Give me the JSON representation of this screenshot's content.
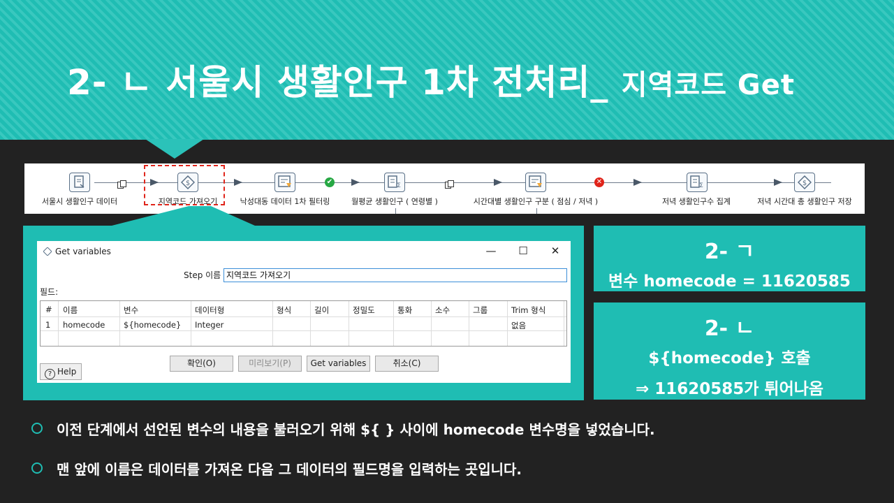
{
  "title": {
    "main": "2- ㄴ 서울시 생활인구 1차 전처리_",
    "sub": "지역코드 Get"
  },
  "pipeline": {
    "steps": [
      {
        "label": "서울시 생활인구 데이터",
        "icon": "text-file-input-icon"
      },
      {
        "label": "지역코드 가져오기",
        "icon": "get-variables-icon"
      },
      {
        "label": "낙성대동 데이터 1차 필터링",
        "icon": "filter-rows-icon"
      },
      {
        "label": "월평균 생활인구 ( 연령별 )",
        "icon": "group-by-icon"
      },
      {
        "label": "시간대별 생활인구 구분 ( 점심 / 저녁 )",
        "icon": "filter-rows-icon"
      },
      {
        "label": "저녁 생활인구수 집계",
        "icon": "group-by-icon"
      },
      {
        "label": "저녁 시간대 총 생활인구 저장",
        "icon": "output-icon"
      }
    ]
  },
  "dialog": {
    "title": "Get variables",
    "step_name_label": "Step 이름",
    "step_name_value": "지역코드 가져오기",
    "fields_label": "필드:",
    "columns": [
      "#",
      "이름",
      "변수",
      "데이터형",
      "형식",
      "길이",
      "정밀도",
      "통화",
      "소수",
      "그룹",
      "Trim 형식"
    ],
    "rows": [
      {
        "num": "1",
        "name": "homecode",
        "variable": "${homecode}",
        "type": "Integer",
        "format": "",
        "length": "",
        "precision": "",
        "currency": "",
        "decimal": "",
        "group": "",
        "trim": "없음"
      }
    ],
    "buttons": {
      "ok": "확인(O)",
      "preview": "미리보기(P)",
      "get_vars": "Get variables",
      "cancel": "취소(C)"
    },
    "help": "Help"
  },
  "box1": {
    "title": "2- ㄱ",
    "line1": "변수 homecode = 11620585"
  },
  "box2": {
    "title": "2- ㄴ",
    "line1": "${homecode} 호출",
    "line2": "⇒ 11620585가 튀어나옴"
  },
  "bullets": [
    "이전 단계에서 선언된 변수의 내용을 불러오기 위해 ${ } 사이에 homecode 변수명을 넣었습니다.",
    "맨 앞에 이름은 데이터를 가져온 다음 그 데이터의 필드명을 입력하는 곳입니다."
  ],
  "colors": {
    "accent": "#1fbdb3",
    "background": "#222222",
    "selection": "#e0241a"
  }
}
